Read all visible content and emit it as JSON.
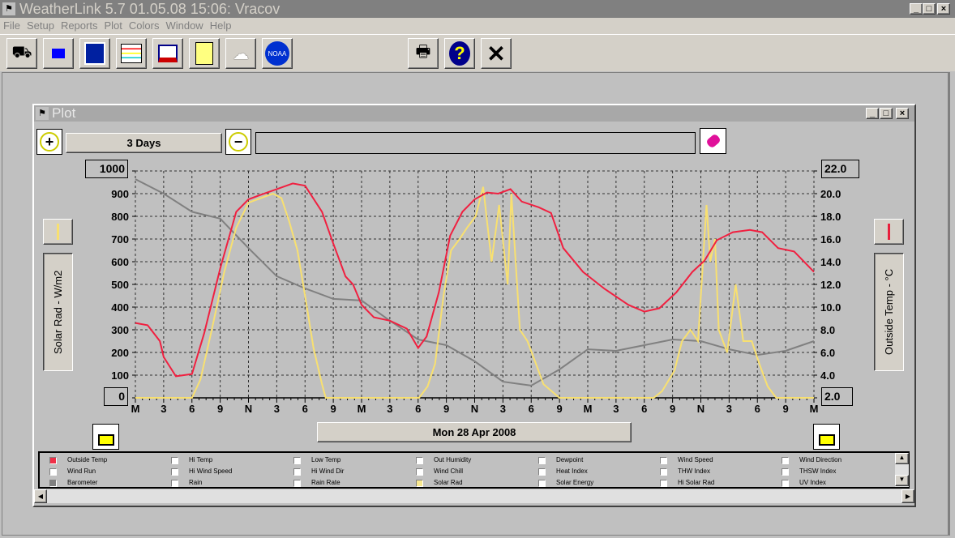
{
  "app": {
    "title": "WeatherLink 5.7  01.05.08  15:06: Vracov",
    "window_controls": [
      "_",
      "□",
      "×"
    ]
  },
  "menu": [
    "File",
    "Setup",
    "Reports",
    "Plot",
    "Colors",
    "Window",
    "Help"
  ],
  "toolbar": {
    "tools": [
      "station-icon",
      "download-icon",
      "bulletin-icon",
      "strip-charts-icon",
      "plot-icon",
      "notebook-icon",
      "weather-icon",
      "noaa-icon"
    ],
    "right_tools": [
      "print-icon",
      "help-icon",
      "exit-icon"
    ],
    "noaa_label": "NOAA"
  },
  "plot_window": {
    "title": "Plot",
    "span": "3 Days",
    "range_field": "",
    "date": "Mon 28 Apr 2008"
  },
  "left_axis": {
    "label": "Solar Rad - W/m2",
    "max_box": "1000",
    "min_box": "0",
    "ticks": [
      "1000",
      "900",
      "800",
      "700",
      "600",
      "500",
      "400",
      "300",
      "200",
      "100",
      "0"
    ],
    "color": "#f8e070"
  },
  "right_axis": {
    "label": "Outside Temp - °C",
    "max_box": "22.0",
    "min_box": "2.0",
    "ticks": [
      "22.0",
      "20.0",
      "18.0",
      "16.0",
      "14.0",
      "12.0",
      "10.0",
      "8.0",
      "6.0",
      "4.0",
      "2.0"
    ],
    "color": "#e8203c"
  },
  "legend": [
    [
      "Outside Temp",
      "Hi Temp",
      "Low Temp",
      "Out Humidity",
      "Dewpoint",
      "Wind Speed",
      "Wind Direction"
    ],
    [
      "Wind Run",
      "Hi Wind Speed",
      "Hi Wind Dir",
      "Wind Chill",
      "Heat Index",
      "THW Index",
      "THSW Index"
    ],
    [
      "Barometer",
      "Rain",
      "Rain Rate",
      "Solar Rad",
      "Solar Energy",
      "Hi Solar Rad",
      "UV Index"
    ]
  ],
  "legend_colors": {
    "Outside Temp": "#f03048",
    "Barometer": "#808080",
    "Solar Rad": "#f8e890"
  },
  "chart_data": {
    "type": "line",
    "grid": true,
    "x_ticks": [
      "M",
      "3",
      "6",
      "9",
      "N",
      "3",
      "6",
      "9",
      "M",
      "3",
      "6",
      "9",
      "N",
      "3",
      "6",
      "9",
      "M",
      "3",
      "6",
      "9",
      "N",
      "3",
      "6",
      "9",
      "M"
    ],
    "x_range_hours": [
      0,
      72
    ],
    "left_ylim": [
      0,
      1000
    ],
    "right_ylim": [
      2.0,
      22.0
    ],
    "series": [
      {
        "name": "Outside Temp",
        "axis": "right",
        "color": "#f02040",
        "hours": [
          0,
          1.3,
          2.6,
          3,
          4.3,
          6,
          7.3,
          9,
          10.7,
          12,
          13.3,
          15,
          16.7,
          18,
          19.8,
          21,
          22.3,
          23.1,
          24,
          25.3,
          27,
          28.8,
          30,
          30.9,
          32.2,
          33.4,
          34.7,
          36,
          37.3,
          38.5,
          39.8,
          41,
          42.8,
          44.1,
          45.4,
          47.5,
          49.8,
          52.3,
          54,
          55.6,
          57.4,
          59.1,
          60.4,
          61.7,
          63.4,
          65.2,
          66.5,
          68.2,
          69.9,
          72
        ],
        "values": [
          8.6,
          8.4,
          7.0,
          5.6,
          3.9,
          4.1,
          7.7,
          13.4,
          18.4,
          19.5,
          19.9,
          20.4,
          20.9,
          20.7,
          18.4,
          15.6,
          12.7,
          12.0,
          10.2,
          9.1,
          8.8,
          8.1,
          6.4,
          7.4,
          11.3,
          16.3,
          18.4,
          19.5,
          20.1,
          20.0,
          20.4,
          19.3,
          18.8,
          18.3,
          15.2,
          13.1,
          11.6,
          10.2,
          9.6,
          9.9,
          11.3,
          13.1,
          14.1,
          15.9,
          16.6,
          16.8,
          16.6,
          15.2,
          14.9,
          13.1
        ]
      },
      {
        "name": "Barometer",
        "axis": "left",
        "color": "#808080",
        "hours": [
          0,
          3,
          6,
          9,
          12,
          15,
          18,
          21,
          24,
          27,
          30,
          33,
          36,
          39,
          42,
          45,
          48,
          51,
          54,
          57,
          60,
          63,
          66,
          69,
          72
        ],
        "values": [
          964,
          900,
          820,
          790,
          660,
          536,
          482,
          436,
          429,
          340,
          257,
          232,
          161,
          71,
          54,
          125,
          214,
          207,
          232,
          257,
          250,
          214,
          189,
          207,
          250
        ]
      },
      {
        "name": "Solar Rad",
        "axis": "left",
        "color": "#f8e070",
        "hours": [
          0,
          6,
          6.9,
          8.1,
          9.4,
          10.7,
          12,
          13.3,
          14.6,
          15.5,
          16.3,
          17.2,
          18,
          18.9,
          19.8,
          20.2,
          30.1,
          31,
          31.8,
          32.7,
          33.5,
          34.4,
          35.2,
          36.1,
          36.9,
          37.8,
          38.6,
          39.5,
          39.9,
          40.8,
          41.6,
          42.5,
          43.3,
          45,
          55,
          55.9,
          57.2,
          58,
          58.9,
          59.7,
          60.6,
          61,
          61.5,
          61.9,
          62.8,
          63.7,
          64.5,
          65.4,
          66.2,
          67.1,
          68,
          72
        ],
        "values": [
          0,
          0,
          80,
          300,
          550,
          750,
          860,
          880,
          900,
          880,
          780,
          650,
          450,
          220,
          60,
          0,
          0,
          50,
          150,
          450,
          650,
          700,
          750,
          800,
          930,
          600,
          850,
          500,
          900,
          300,
          250,
          150,
          60,
          0,
          0,
          30,
          120,
          250,
          300,
          250,
          850,
          600,
          700,
          300,
          200,
          500,
          250,
          250,
          150,
          50,
          0,
          0
        ]
      }
    ]
  }
}
